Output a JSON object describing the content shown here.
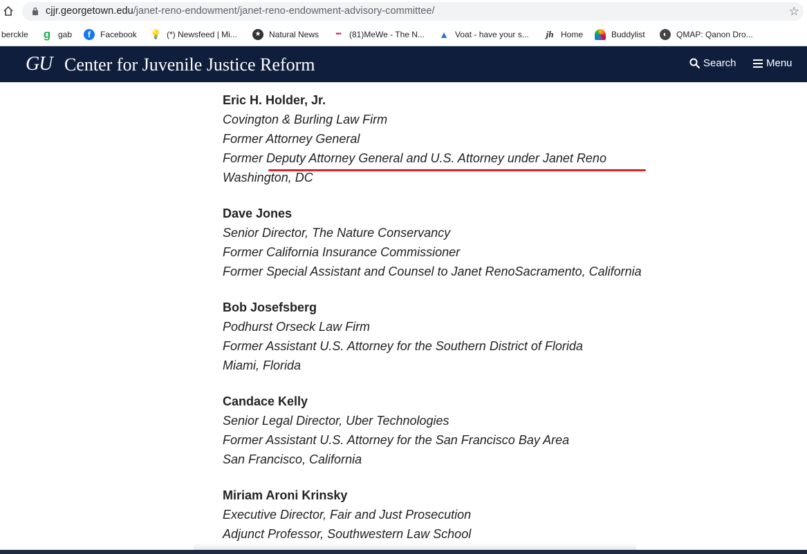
{
  "browser": {
    "url_domain": "cjjr.georgetown.edu",
    "url_path": "/janet-reno-endowment/janet-reno-endowment-advisory-committee/",
    "bookmarks": [
      {
        "label": "berckle",
        "icon": ""
      },
      {
        "label": "gab",
        "icon": "gab-icon"
      },
      {
        "label": "Facebook",
        "icon": "facebook-icon"
      },
      {
        "label": "(*) Newsfeed | Mi...",
        "icon": "lightbulb-icon"
      },
      {
        "label": "Natural News",
        "icon": "star-circle-icon"
      },
      {
        "label": "(81)MeWe - The N...",
        "icon": "dots-icon"
      },
      {
        "label": "Voat - have your s...",
        "icon": "triangle-icon"
      },
      {
        "label": "Home",
        "icon": "jh-icon"
      },
      {
        "label": "Buddylist",
        "icon": "peacock-icon"
      },
      {
        "label": "QMAP: Qanon Dro...",
        "icon": "globe-icon"
      }
    ]
  },
  "header": {
    "logo": "GU",
    "title": "Center for Juvenile Justice Reform",
    "search_label": "Search",
    "menu_label": "Menu",
    "background": "#0f1e3d"
  },
  "members": [
    {
      "name": "Eric H. Holder, Jr.",
      "lines": [
        "Covington & Burling Law Firm",
        "Former Attorney General",
        "Former Deputy Attorney General and U.S. Attorney under Janet Reno",
        "Washington, DC"
      ]
    },
    {
      "name": "Dave Jones",
      "lines": [
        "Senior Director, The Nature Conservancy",
        "Former California Insurance Commissioner",
        "Former Special Assistant and Counsel to Janet RenoSacramento, California"
      ]
    },
    {
      "name": "Bob Josefsberg",
      "lines": [
        "Podhurst Orseck Law Firm",
        "Former Assistant U.S. Attorney for the Southern District of Florida",
        "Miami, Florida"
      ]
    },
    {
      "name": "Candace Kelly",
      "lines": [
        "Senior Legal Director, Uber Technologies",
        "Former Assistant U.S. Attorney for the San Francisco Bay Area",
        "San Francisco, California"
      ]
    },
    {
      "name": "Miriam Aroni Krinsky",
      "lines": [
        "Executive Director, Fair and Just Prosecution",
        "Adjunct Professor, Southwestern Law School"
      ]
    }
  ],
  "annotation_color": "#e02020"
}
